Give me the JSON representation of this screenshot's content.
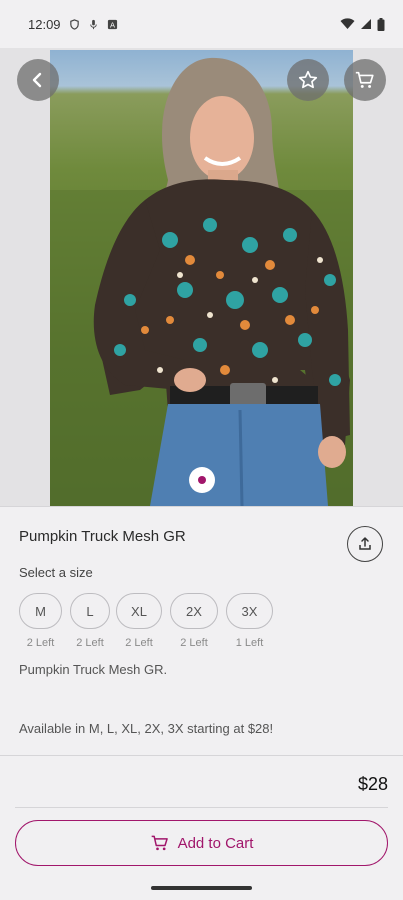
{
  "status_bar": {
    "time": "12:09",
    "icons_left": [
      "shield-icon",
      "mic-off-icon",
      "notification-a-icon"
    ],
    "icons_right": [
      "wifi-icon",
      "cell-signal-icon",
      "battery-icon"
    ]
  },
  "hero": {
    "image_description_icon": "product-photo",
    "carousel_active_index": 0,
    "carousel_count": 1
  },
  "product": {
    "title": "Pumpkin Truck Mesh GR",
    "size_prompt": "Select a size",
    "sizes": [
      {
        "label": "M",
        "stock": "2 Left"
      },
      {
        "label": "L",
        "stock": "2 Left"
      },
      {
        "label": "XL",
        "stock": "2 Left"
      },
      {
        "label": "2X",
        "stock": "2 Left"
      },
      {
        "label": "3X",
        "stock": "1 Left"
      }
    ],
    "description_line1": "Pumpkin Truck Mesh GR.",
    "description_line2": "Available in M, L, XL, 2X, 3X starting at $28!",
    "price": "$28"
  },
  "actions": {
    "add_to_cart_label": "Add to Cart"
  },
  "colors": {
    "accent": "#a1166b",
    "background": "#f1f0f2"
  }
}
